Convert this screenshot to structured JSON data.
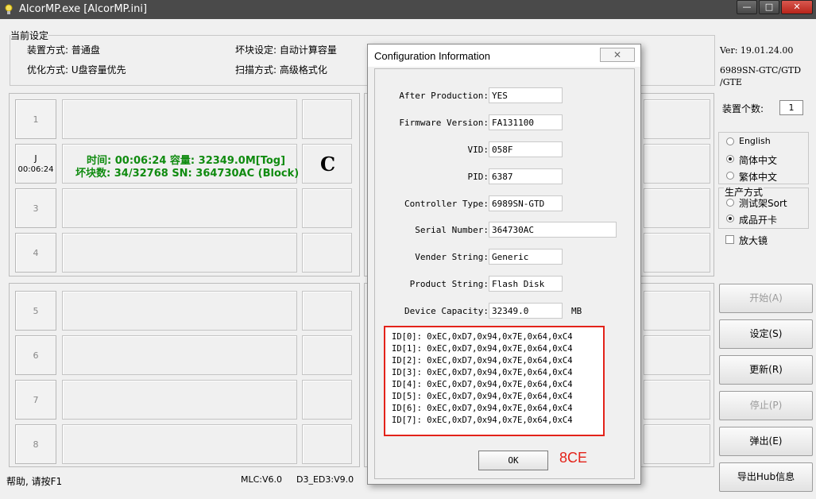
{
  "window": {
    "title": "AlcorMP.exe [AlcorMP.ini]",
    "minimize": "—",
    "maximize": "□",
    "close": "✕"
  },
  "current_settings": {
    "legend": "当前设定",
    "device_mode": "装置方式: 普通盘",
    "bad_block": "坏块设定: 自动计算容量",
    "optimize": "优化方式: U盘容量优先",
    "scan_mode": "扫描方式: 高级格式化"
  },
  "right_panel": {
    "version": "Ver: 19.01.24.00",
    "chip_line1": "6989SN-GTC/GTD",
    "chip_line2": "/GTE",
    "device_count_label": "装置个数:",
    "device_count": "1",
    "languages": [
      "English",
      "简体中文",
      "繁体中文"
    ],
    "language_selected": 1,
    "production_legend": "生产方式",
    "production_options": [
      "测试架Sort",
      "成品开卡"
    ],
    "production_selected": 1,
    "magnifier": "放大镜"
  },
  "buttons": {
    "start": "开始(A)",
    "settings": "设定(S)",
    "refresh": "更新(R)",
    "stop": "停止(P)",
    "eject": "弹出(E)",
    "export_hub": "导出Hub信息"
  },
  "ports": {
    "slot1": "1",
    "slot2_letter": "J",
    "slot2_time": "00:06:24",
    "slot3": "3",
    "slot4": "4",
    "slot5": "5",
    "slot6": "6",
    "slot7": "7",
    "slot8": "8",
    "active_line1": "时间: 00:06:24 容量: 32349.0M[Tog]",
    "active_line2": "坏块数: 34/32768 SN: 364730AC (Block)",
    "drive_letter": "C"
  },
  "status_bar": {
    "help": "帮助, 请按F1",
    "mlc": "MLC:V6.0",
    "d3": "D3_ED3:V9.0"
  },
  "dialog": {
    "title": "Configuration Information",
    "close": "✕",
    "fields": {
      "after_production_label": "After Production:",
      "after_production": "YES",
      "firmware_label": "Firmware Version:",
      "firmware": "FA131100",
      "vid_label": "VID:",
      "vid": "058F",
      "pid_label": "PID:",
      "pid": "6387",
      "controller_label": "Controller Type:",
      "controller": "6989SN-GTD",
      "serial_label": "Serial Number:",
      "serial": "364730AC",
      "vender_label": "Vender String:",
      "vender": "Generic",
      "product_label": "Product String:",
      "product": "Flash Disk",
      "capacity_label": "Device Capacity:",
      "capacity": "32349.0",
      "capacity_unit": "MB"
    },
    "ids": [
      "ID[0]: 0xEC,0xD7,0x94,0x7E,0x64,0xC4",
      "ID[1]: 0xEC,0xD7,0x94,0x7E,0x64,0xC4",
      "ID[2]: 0xEC,0xD7,0x94,0x7E,0x64,0xC4",
      "ID[3]: 0xEC,0xD7,0x94,0x7E,0x64,0xC4",
      "ID[4]: 0xEC,0xD7,0x94,0x7E,0x64,0xC4",
      "ID[5]: 0xEC,0xD7,0x94,0x7E,0x64,0xC4",
      "ID[6]: 0xEC,0xD7,0x94,0x7E,0x64,0xC4",
      "ID[7]: 0xEC,0xD7,0x94,0x7E,0x64,0xC4"
    ],
    "ok": "OK",
    "annotation": "8CE"
  },
  "colors": {
    "highlight_red": "#e3231a",
    "status_green": "#108b10"
  }
}
